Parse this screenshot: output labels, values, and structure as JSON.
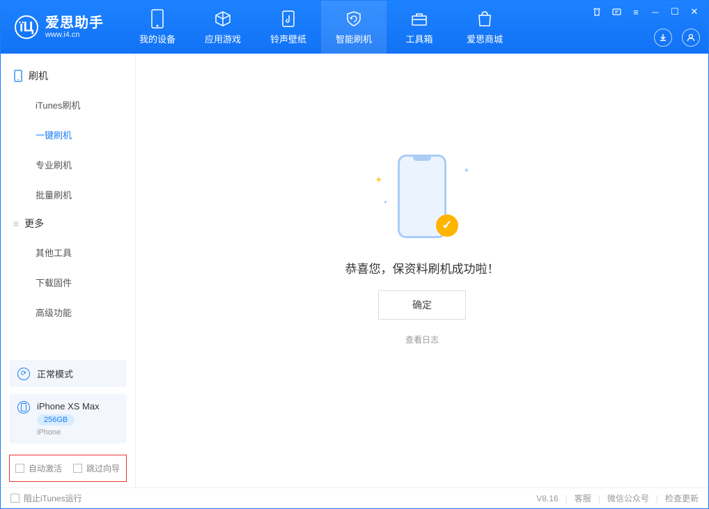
{
  "brand": {
    "title": "爱思助手",
    "subtitle": "www.i4.cn"
  },
  "tabs": [
    {
      "label": "我的设备"
    },
    {
      "label": "应用游戏"
    },
    {
      "label": "铃声壁纸"
    },
    {
      "label": "智能刷机"
    },
    {
      "label": "工具箱"
    },
    {
      "label": "爱思商城"
    }
  ],
  "sidebar": {
    "section1": {
      "title": "刷机",
      "items": [
        "iTunes刷机",
        "一键刷机",
        "专业刷机",
        "批量刷机"
      ]
    },
    "section2": {
      "title": "更多",
      "items": [
        "其他工具",
        "下载固件",
        "高级功能"
      ]
    }
  },
  "mode_card": {
    "label": "正常模式"
  },
  "device_card": {
    "name": "iPhone XS Max",
    "storage": "256GB",
    "type": "iPhone"
  },
  "checks": {
    "auto_activate": "自动激活",
    "skip_guide": "跳过向导"
  },
  "main": {
    "message": "恭喜您，保资料刷机成功啦！",
    "ok": "确定",
    "view_log": "查看日志"
  },
  "footer": {
    "block_itunes": "阻止iTunes运行",
    "version": "V8.16",
    "service": "客服",
    "wechat": "微信公众号",
    "check_update": "检查更新"
  }
}
